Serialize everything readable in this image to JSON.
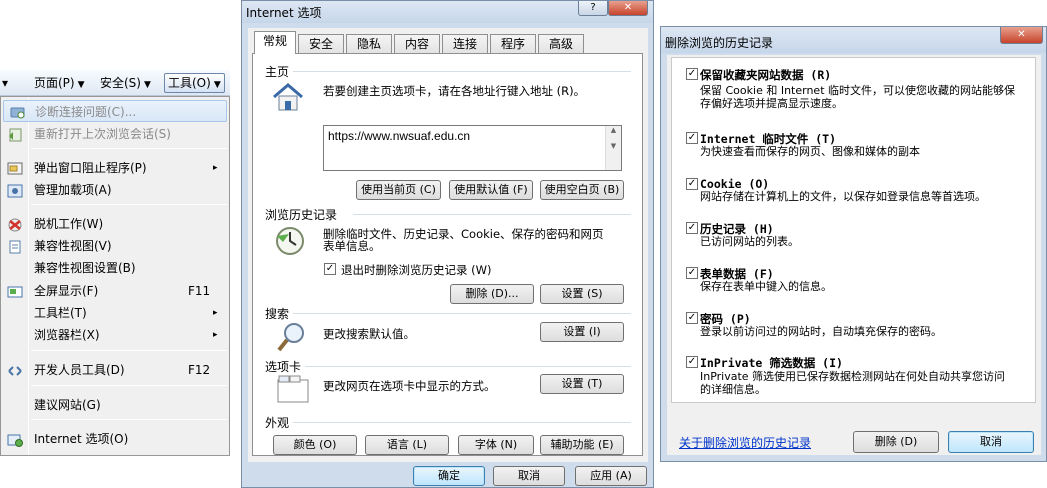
{
  "menu": {
    "commandbar": {
      "left_arrow": "▾",
      "page_label": "页面(P)",
      "safety_label": "安全(S)",
      "tools_label": "工具(O)",
      "dropdown_glyph": "▼"
    },
    "items": [
      {
        "label": "诊断连接问题(C)...",
        "shortcut": "",
        "icon": "diagnose-connection-icon",
        "disabled": true
      },
      {
        "label": "重新打开上次浏览会话(S)",
        "shortcut": "",
        "icon": "reopen-session-icon",
        "disabled": true
      },
      {
        "label": "弹出窗口阻止程序(P)",
        "shortcut": "",
        "icon": "popup-blocker-icon",
        "submenu": true
      },
      {
        "label": "管理加载项(A)",
        "shortcut": "",
        "icon": "manage-addons-icon"
      },
      {
        "label": "脱机工作(W)",
        "shortcut": "",
        "icon": "work-offline-icon"
      },
      {
        "label": "兼容性视图(V)",
        "shortcut": "",
        "icon": "compat-view-icon"
      },
      {
        "label": "兼容性视图设置(B)",
        "shortcut": ""
      },
      {
        "label": "全屏显示(F)",
        "shortcut": "F11",
        "icon": "fullscreen-icon"
      },
      {
        "label": "工具栏(T)",
        "shortcut": "",
        "submenu": true
      },
      {
        "label": "浏览器栏(X)",
        "shortcut": "",
        "submenu": true
      },
      {
        "label": "开发人员工具(D)",
        "shortcut": "F12",
        "icon": "developer-tools-icon"
      },
      {
        "label": "建议网站(G)",
        "shortcut": ""
      },
      {
        "label": "Internet 选项(O)",
        "shortcut": "",
        "icon": "internet-options-icon"
      }
    ],
    "submenu_glyph": "▸"
  },
  "inet": {
    "title": "Internet 选项",
    "help_glyph": "?",
    "close_glyph": "✕",
    "tabs": [
      "常规",
      "安全",
      "隐私",
      "内容",
      "连接",
      "程序",
      "高级"
    ],
    "active_tab": "常规",
    "home": {
      "group": "主页",
      "hint": "若要创建主页选项卡，请在各地址行键入地址 (R)。",
      "url": "https://www.nwsuaf.edu.cn",
      "use_current": "使用当前页 (C)",
      "use_default": "使用默认值 (F)",
      "use_blank": "使用空白页 (B)"
    },
    "history": {
      "group": "浏览历史记录",
      "desc_line1": "删除临时文件、历史记录、Cookie、保存的密码和网页",
      "desc_line2": "表单信息。",
      "checkbox_label": "退出时删除浏览历史记录 (W)",
      "checked": true,
      "delete_button": "删除 (D)...",
      "settings_button": "设置 (S)"
    },
    "search": {
      "group": "搜索",
      "desc": "更改搜索默认值。",
      "settings_button": "设置 (I)"
    },
    "tabs_group": {
      "group": "选项卡",
      "desc": "更改网页在选项卡中显示的方式。",
      "settings_button": "设置 (T)"
    },
    "appearance": {
      "group": "外观",
      "colors": "颜色 (O)",
      "languages": "语言 (L)",
      "fonts": "字体 (N)",
      "accessibility": "辅助功能 (E)"
    },
    "footer": {
      "ok": "确定",
      "cancel": "取消",
      "apply": "应用 (A)"
    }
  },
  "delete_history": {
    "title": "删除浏览的历史记录",
    "close_glyph": "✕",
    "check_glyph": "✓",
    "options": [
      {
        "title": "保留收藏夹网站数据 (R)",
        "desc1": "保留 Cookie 和 Internet 临时文件，可以使您收藏的网站能够保",
        "desc2": "存偏好选项并提高显示速度。",
        "checked": true
      },
      {
        "title": "Internet 临时文件 (T)",
        "desc1": "为快速查看而保存的网页、图像和媒体的副本",
        "desc2": "",
        "checked": true
      },
      {
        "title": "Cookie (O)",
        "desc1": "网站存储在计算机上的文件，以保存如登录信息等首选项。",
        "desc2": "",
        "checked": true
      },
      {
        "title": "历史记录 (H)",
        "desc1": "已访问网站的列表。",
        "desc2": "",
        "checked": true
      },
      {
        "title": "表单数据 (F)",
        "desc1": "保存在表单中键入的信息。",
        "desc2": "",
        "checked": true
      },
      {
        "title": "密码 (P)",
        "desc1": "登录以前访问过的网站时，自动填充保存的密码。",
        "desc2": "",
        "checked": true
      },
      {
        "title": "InPrivate 筛选数据 (I)",
        "desc1": "InPrivate 筛选使用已保存数据检测网站在何处自动共享您访问",
        "desc2": "的详细信息。",
        "checked": true
      }
    ],
    "about_link": "关于删除浏览的历史记录",
    "delete_button": "删除 (D)",
    "cancel_button": "取消"
  }
}
